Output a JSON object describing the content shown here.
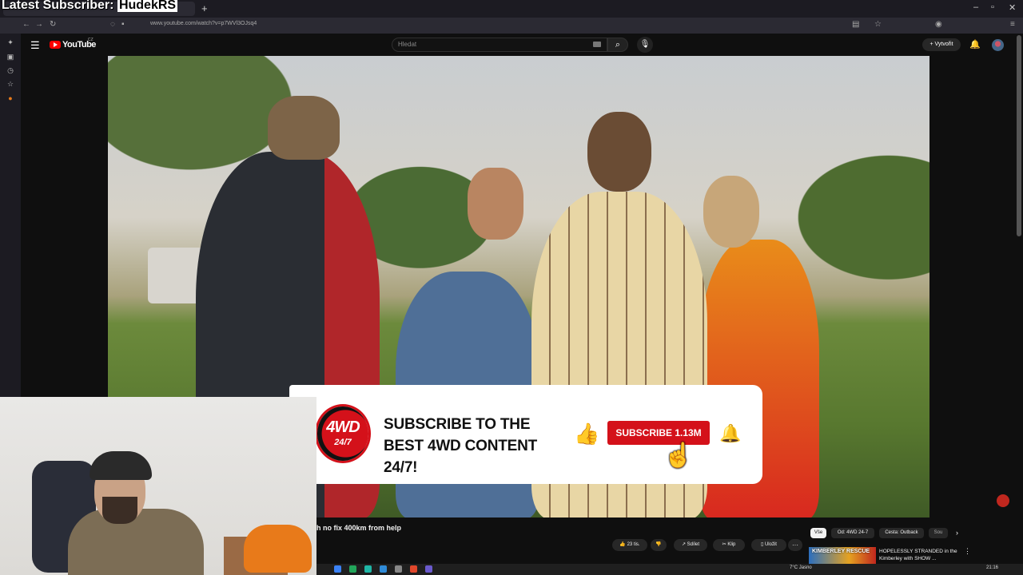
{
  "stream_overlay": {
    "prefix": "Latest Subscriber: ",
    "subscriber": "HudekRS"
  },
  "browser": {
    "url": "www.youtube.com/watch?v=p7WVl3OJsq4",
    "new_tab": "+",
    "window_controls": [
      "–",
      "▫",
      "✕"
    ]
  },
  "youtube": {
    "logo_text": "YouTube",
    "logo_superscript": "CZ",
    "search_placeholder": "Hledat",
    "create_label": "+ Vytvořit"
  },
  "subscribe_card": {
    "logo_main": "4WD",
    "logo_sub": "24/7",
    "headline": "SUBSCRIBE TO THE BEST 4WD CONTENT 24/7!",
    "button_label": "SUBSCRIBE 1.13M"
  },
  "video": {
    "title_visible": "h no fix 400km from help",
    "actions": {
      "likes": "23 tis.",
      "share": "Sdílet",
      "clip": "Klip",
      "save": "Uložit",
      "more": "···"
    }
  },
  "recommendations": {
    "chips": [
      "Vše",
      "Od: 4WD 24-7",
      "Cesta: Outback",
      "Sou"
    ],
    "item": {
      "thumb_text": "KIMBERLEY RESCUE",
      "title": "HOPELESSLY STRANDED in the Kimberley with SHOW ..."
    }
  },
  "taskbar": {
    "weather": "7°C Jasno",
    "time": "21:16"
  },
  "colors": {
    "youtube_red": "#ff0000",
    "subscribe_red": "#d4111a",
    "like_blue": "#1e6fd9"
  }
}
